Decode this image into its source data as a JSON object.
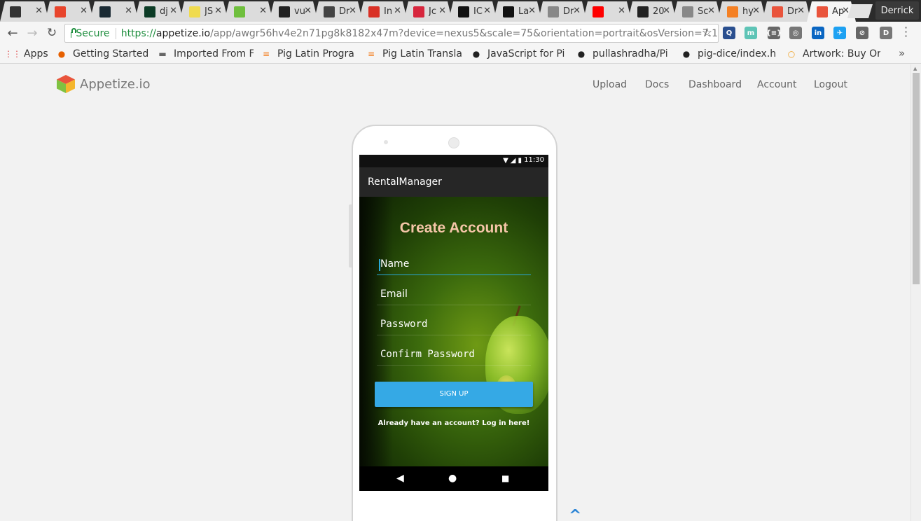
{
  "browser": {
    "tabs": [
      {
        "icon": "pencil-icon",
        "title": "",
        "color": "#333333"
      },
      {
        "icon": "x-logo-icon",
        "title": "",
        "color": "#e8452c"
      },
      {
        "icon": "react-icon",
        "title": "",
        "color": "#1a2a33"
      },
      {
        "icon": "django-icon",
        "title": "dj",
        "color": "#0c3c26"
      },
      {
        "icon": "js-icon",
        "title": "JS",
        "color": "#f0db4f"
      },
      {
        "icon": "regex-icon",
        "title": "",
        "color": "#6fbf3d"
      },
      {
        "icon": "github-icon",
        "title": "vu",
        "color": "#222222"
      },
      {
        "icon": "code-icon",
        "title": "Dr",
        "color": "#444444"
      },
      {
        "icon": "gmail-icon",
        "title": "In",
        "color": "#d93025"
      },
      {
        "icon": "app-icon",
        "title": "Jc",
        "color": "#d7263d"
      },
      {
        "icon": "freecodecamp-icon",
        "title": "IC",
        "color": "#111111"
      },
      {
        "icon": "freecodecamp-icon",
        "title": "La",
        "color": "#111111"
      },
      {
        "icon": "doc-icon",
        "title": "Dr",
        "color": "#888888"
      },
      {
        "icon": "youtube-icon",
        "title": "",
        "color": "#ff0000"
      },
      {
        "icon": "camera-icon",
        "title": "20",
        "color": "#222222"
      },
      {
        "icon": "doc-icon",
        "title": "Sc",
        "color": "#888888"
      },
      {
        "icon": "stackoverflow-icon",
        "title": "hy",
        "color": "#f48024"
      },
      {
        "icon": "appetize-icon",
        "title": "Dr",
        "color": "#e9543c"
      },
      {
        "icon": "appetize-icon",
        "title": "Ap",
        "color": "#e9543c",
        "active": true
      }
    ],
    "tab_close_glyph": "✕",
    "profile_name": "Derrick",
    "secure_label": "Secure",
    "url_scheme": "https://",
    "url_host": "appetize.io",
    "url_path": "/app/awgr56hv4e2n71pg8k8182x47m?device=nexus5&scale=75&orientation=portrait&osVersion=7.1",
    "extensions": [
      {
        "icon": "search-ext-icon",
        "label": "Q",
        "color": "#2a4f8f"
      },
      {
        "icon": "m-ext-icon",
        "label": "m",
        "color": "#5ec4b6"
      },
      {
        "icon": "json-ext-icon",
        "label": "{≡}",
        "color": "#666666"
      },
      {
        "icon": "eye-ext-icon",
        "label": "◎",
        "color": "#777777"
      },
      {
        "icon": "linkedin-icon",
        "label": "in",
        "color": "#0a66c2"
      },
      {
        "icon": "bird-ext-icon",
        "label": "✈",
        "color": "#1da1f2"
      },
      {
        "icon": "block-ext-icon",
        "label": "⊘",
        "color": "#666666"
      },
      {
        "icon": "d-ext-icon",
        "label": "D",
        "color": "#777777"
      }
    ]
  },
  "bookmarks": [
    {
      "icon": "apps-icon",
      "label": "Apps"
    },
    {
      "icon": "firefox-icon",
      "label": "Getting Started"
    },
    {
      "icon": "folder-icon",
      "label": "Imported From F"
    },
    {
      "icon": "stackoverflow-icon",
      "label": "Pig Latin Progra"
    },
    {
      "icon": "stackoverflow-icon",
      "label": "Pig Latin Transla"
    },
    {
      "icon": "github-icon",
      "label": "JavaScript for Pi"
    },
    {
      "icon": "github-icon",
      "label": "pullashradha/Pi"
    },
    {
      "icon": "github-icon",
      "label": "pig-dice/index.h"
    },
    {
      "icon": "artwork-icon",
      "label": "Artwork: Buy Or"
    }
  ],
  "site": {
    "logo_text": "Appetize.io",
    "nav": [
      "Upload",
      "Docs",
      "Dashboard",
      "Account",
      "Logout"
    ]
  },
  "device": {
    "status_time": "11:30",
    "app_title": "RentalManager",
    "screen_title": "Create Account",
    "fields": [
      {
        "label": "Name",
        "focused": true
      },
      {
        "label": "Email"
      },
      {
        "label": "Password"
      },
      {
        "label": "Confirm Password"
      }
    ],
    "signup_label": "SIGN UP",
    "login_prompt": "Already have an account? Log in here!",
    "nav_back": "◀",
    "nav_home": "●",
    "nav_recents": "■"
  },
  "colors": {
    "accent_green": "#1e8e3e",
    "signup_blue": "#35a9e5",
    "title_peach": "#f5c6a8"
  }
}
